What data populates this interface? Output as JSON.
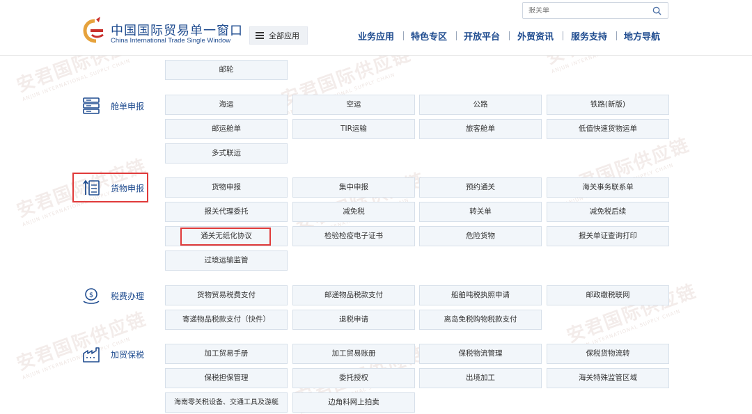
{
  "header": {
    "logo_title": "中国国际贸易单一窗口",
    "logo_subtitle": "China International Trade Single Window",
    "all_apps_label": "全部应用",
    "search_placeholder": "报关单",
    "nav": [
      "业务应用",
      "特色专区",
      "开放平台",
      "外贸资讯",
      "服务支持",
      "地方导航"
    ]
  },
  "categories": {
    "ship": "舱单申报",
    "goods": "货物申报",
    "tax": "税费办理",
    "bonded": "加贸保税"
  },
  "buttons": {
    "mail_ship": "邮轮",
    "sea": "海运",
    "air": "空运",
    "road": "公路",
    "rail": "铁路(新版)",
    "post_manifest": "邮运舱单",
    "tir": "TIR运输",
    "passenger_manifest": "旅客舱单",
    "low_value": "低值快速货物运单",
    "multimodal": "多式联运",
    "goods_declare": "货物申报",
    "centralized": "集中申报",
    "pre_clearance": "预约通关",
    "customs_contact": "海关事务联系单",
    "agency": "报关代理委托",
    "tax_reduction": "减免税",
    "transit_doc": "转关单",
    "tax_reduction_follow": "减免税后续",
    "paperless": "通关无纸化协议",
    "inspection_cert": "检验检疫电子证书",
    "dangerous": "危险货物",
    "declaration_print": "报关单证查询打印",
    "transit_supervision": "过境运输监管",
    "goods_tax_pay": "货物贸易税费支付",
    "post_tax_pay": "邮递物品税款支付",
    "tonnage": "船舶吨税执照申请",
    "post_tax_network": "邮政缴税联网",
    "mail_tax_pay": "寄递物品税款支付（快件）",
    "refund": "退税申请",
    "island_dutyfree": "离岛免税购物税款支付",
    "processing_manual": "加工贸易手册",
    "processing_account": "加工贸易账册",
    "bonded_logistics": "保税物流管理",
    "bonded_transfer": "保税货物流转",
    "bonded_guarantee": "保税担保管理",
    "entrust": "委托授权",
    "outbound_processing": "出境加工",
    "special_zone": "海关特殊监管区域",
    "hainan_zero": "海南零关税设备、交通工具及游艇",
    "scrap_auction": "边角料网上拍卖"
  },
  "watermark": {
    "text": "安君国际供应链",
    "sub": "ANJUN INTERNATIONAL SUPPLY CHAIN"
  },
  "colors": {
    "brand_blue": "#1e4b8f",
    "highlight_red": "#e03a3a",
    "button_bg": "#f2f6fa"
  }
}
